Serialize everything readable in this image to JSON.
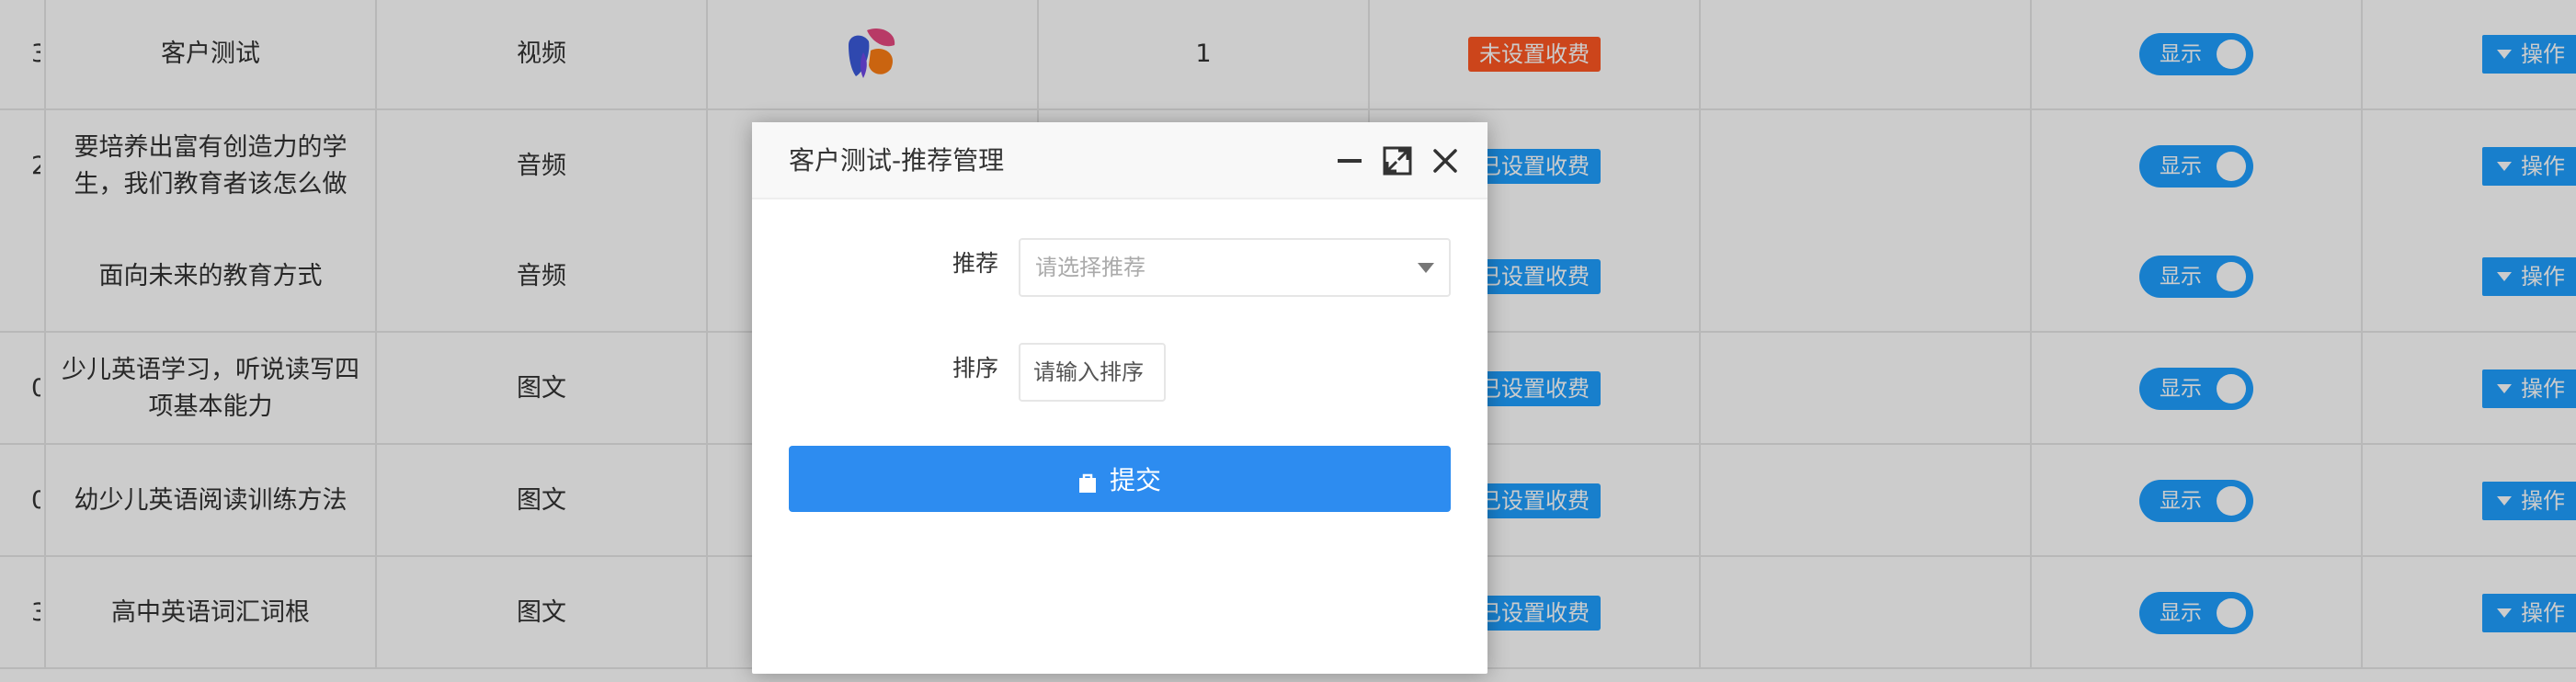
{
  "table": {
    "rows": [
      {
        "id_fragment": "3",
        "title": "客户测试",
        "type": "视频",
        "has_thumb": true,
        "count": "1",
        "fee_status": "未设置收费",
        "fee_color": "orange",
        "display_label": "显示",
        "action_label": "操作"
      },
      {
        "id_fragment": "2",
        "title": "要培养出富有创造力的学生，我们教育者该怎么做",
        "type": "音频",
        "has_thumb": false,
        "count": "",
        "fee_status": "已设置收费",
        "fee_color": "blue",
        "display_label": "显示",
        "action_label": "操作"
      },
      {
        "id_fragment": "",
        "title": "面向未来的教育方式",
        "type": "音频",
        "has_thumb": false,
        "count": "",
        "fee_status": "已设置收费",
        "fee_color": "blue",
        "display_label": "显示",
        "action_label": "操作"
      },
      {
        "id_fragment": "0",
        "title": "少儿英语学习，听说读写四项基本能力",
        "type": "图文",
        "has_thumb": false,
        "count": "",
        "fee_status": "已设置收费",
        "fee_color": "blue",
        "display_label": "显示",
        "action_label": "操作"
      },
      {
        "id_fragment": "0",
        "title": "幼少儿英语阅读训练方法",
        "type": "图文",
        "has_thumb": false,
        "count": "",
        "fee_status": "已设置收费",
        "fee_color": "blue",
        "display_label": "显示",
        "action_label": "操作"
      },
      {
        "id_fragment": "3",
        "title": "高中英语词汇词根",
        "type": "图文",
        "has_thumb": false,
        "count": "",
        "fee_status": "已设置收费",
        "fee_color": "blue",
        "display_label": "显示",
        "action_label": "操作"
      }
    ]
  },
  "modal": {
    "title": "客户测试-推荐管理",
    "icons": {
      "minimize": "minimize-icon",
      "maximize": "maximize-icon",
      "close": "close-icon"
    },
    "recommend": {
      "label": "推荐",
      "placeholder": "请选择推荐"
    },
    "sort": {
      "label": "排序",
      "placeholder": "请输入排序"
    },
    "submit": {
      "label": "提交",
      "icon": "bag-icon"
    }
  },
  "colors": {
    "primary": "#1e9fff",
    "submit": "#2d8cf0",
    "warning": "#ff5722",
    "overlay": "rgba(0,0,0,0.2)"
  }
}
